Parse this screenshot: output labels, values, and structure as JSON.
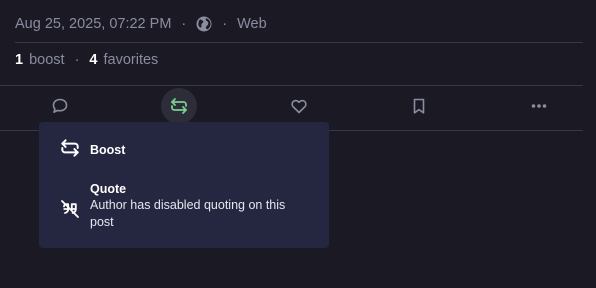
{
  "meta": {
    "timestamp": "Aug 25, 2025, 07:22 PM",
    "separator": "·",
    "visibility_icon": "globe-icon",
    "client": "Web"
  },
  "stats": {
    "boost_count": "1",
    "boost_label": "boost",
    "separator": "·",
    "favorite_count": "4",
    "favorite_label": "favorites"
  },
  "actions": [
    {
      "icon": "reply-icon"
    },
    {
      "icon": "boost-icon",
      "active": true
    },
    {
      "icon": "heart-icon"
    },
    {
      "icon": "bookmark-icon"
    },
    {
      "icon": "more-icon"
    }
  ],
  "menu": {
    "boost": {
      "icon": "boost-icon",
      "title": "Boost"
    },
    "quote": {
      "icon": "quote-disabled-icon",
      "title": "Quote",
      "description": "Author has disabled quoting on this post"
    }
  },
  "colors": {
    "background": "#1b1a24",
    "menu_background": "#252740",
    "muted_text": "#8a8ca0",
    "boost_active": "#7bcf8f"
  }
}
